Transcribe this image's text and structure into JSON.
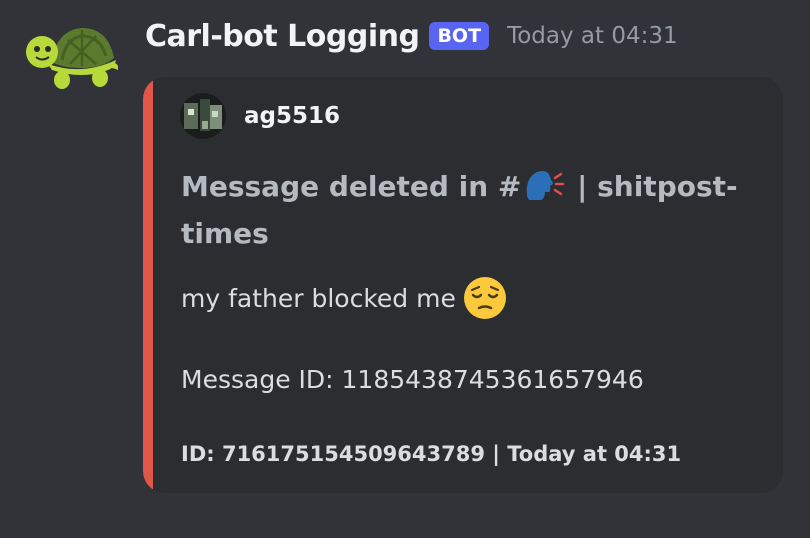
{
  "bot": {
    "name": "Carl-bot Logging",
    "badge": "BOT",
    "timestamp": "Today at 04:31",
    "avatar_icon": "turtle-icon"
  },
  "embed": {
    "accent_color": "#e0574a",
    "author": {
      "name": "ag5516",
      "avatar_icon": "user-avatar"
    },
    "title": {
      "prefix": "Message deleted in #",
      "emoji_icon": "speaking-head-emoji",
      "suffix": " | shitpost-times"
    },
    "description": {
      "text": "my father blocked me",
      "emoji_icon": "pensive-face-emoji"
    },
    "message_id": "Message ID: 1185438745361657946",
    "footer": "ID: 716175154509643789 | Today at 04:31"
  },
  "colors": {
    "background": "#313338",
    "embed_background": "#2b2d31",
    "badge": "#5865f2"
  }
}
